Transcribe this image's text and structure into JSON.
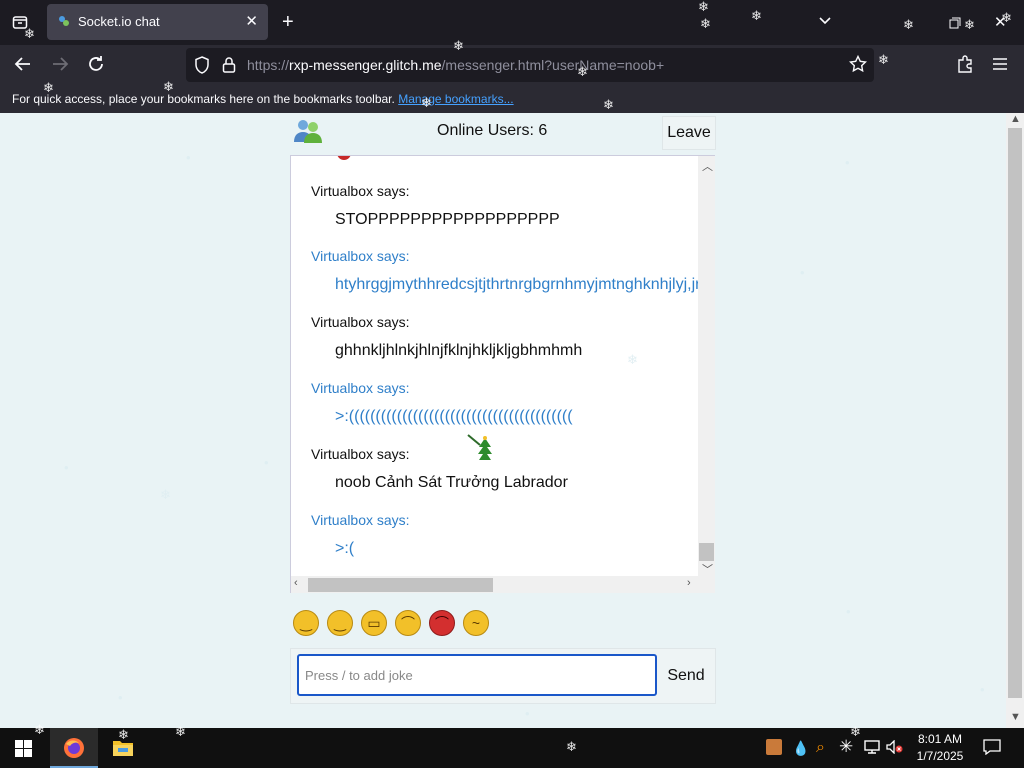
{
  "browser": {
    "tab_title": "Socket.io chat",
    "url_prefix": "https://",
    "url_host": "rxp-messenger.glitch.me",
    "url_path": "/messenger.html?userName=noob+",
    "bookmarks_text": "For quick access, place your bookmarks here on the bookmarks toolbar.",
    "bookmarks_link": "Manage bookmarks..."
  },
  "chat": {
    "online_users": "Online Users: 6",
    "leave_label": "Leave",
    "messages": [
      {
        "who": "Virtualbox says:",
        "text": "STOPPPPPPPPPPPPPPPPPP",
        "color": "dark"
      },
      {
        "who": "Virtualbox says:",
        "text": "htyhrggjmythhredcsjtjthrtnrgbgrnhmyjmtnghknhjlyj,jr",
        "color": "blue"
      },
      {
        "who": "Virtualbox says:",
        "text": "ghhnkljhlnkjhlnjfklnjhkljkljgbhmhmh",
        "color": "dark"
      },
      {
        "who": "Virtualbox says:",
        "text": ">:((((((((((((((((((((((((((((((((((((((((((",
        "color": "blue"
      },
      {
        "who": "Virtualbox says:",
        "text": "noob Cảnh Sát Trưởng Labrador",
        "color": "dark"
      },
      {
        "who": "Virtualbox says:",
        "text": ">:(",
        "color": "blue"
      }
    ],
    "emojis": [
      {
        "name": "smile-emoji-icon",
        "glyph": "◡"
      },
      {
        "name": "wink-emoji-icon",
        "glyph": "◡"
      },
      {
        "name": "grin-emoji-icon",
        "glyph": "▭"
      },
      {
        "name": "sad-emoji-icon",
        "glyph": "◠"
      },
      {
        "name": "angry-emoji-icon",
        "glyph": "◠"
      },
      {
        "name": "sick-emoji-icon",
        "glyph": "~"
      }
    ],
    "input_placeholder": "Press / to add joke",
    "send_label": "Send"
  },
  "taskbar": {
    "time": "8:01 AM",
    "date": "1/7/2025"
  },
  "colors": {
    "accent_blue": "#2f7fc9",
    "page_bg": "#e9f3f5",
    "browser_dark": "#1c1b22",
    "input_border": "#1a57c9"
  }
}
